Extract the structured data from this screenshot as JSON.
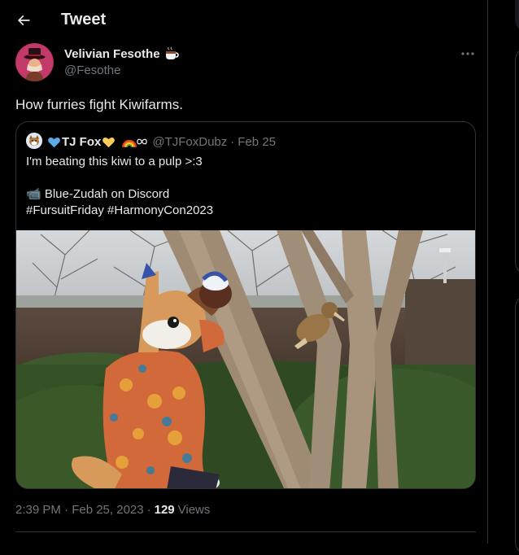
{
  "header": {
    "title": "Tweet",
    "back_icon": "arrow-left-icon"
  },
  "tweet": {
    "author": {
      "name": "Velivian Fesothe",
      "emoji": "coffee-cup-emoji",
      "handle": "@Fesothe"
    },
    "text": "How furries fight Kiwifarms.",
    "timestamp": "2:39 PM · Feb 25, 2023",
    "views": {
      "count": "129",
      "label": "Views"
    }
  },
  "quote": {
    "author": {
      "name": "TJ Fox",
      "handle": "@TJFoxDubz",
      "date": "Feb 25",
      "separator": "·",
      "emojis": [
        "blue-heart-emoji",
        "yellow-heart-emoji",
        "rainbow-emoji",
        "infinity-emoji"
      ]
    },
    "lines": [
      "I'm beating this kiwi to a pulp >:3",
      "",
      "📹 Blue-Zudah on Discord",
      "#FursuitFriday #HarmonyCon2023"
    ],
    "media": "video-thumbnail"
  },
  "colors": {
    "background": "#000000",
    "text": "#e7e9ea",
    "secondary": "#71767b",
    "border": "#2f3336"
  }
}
